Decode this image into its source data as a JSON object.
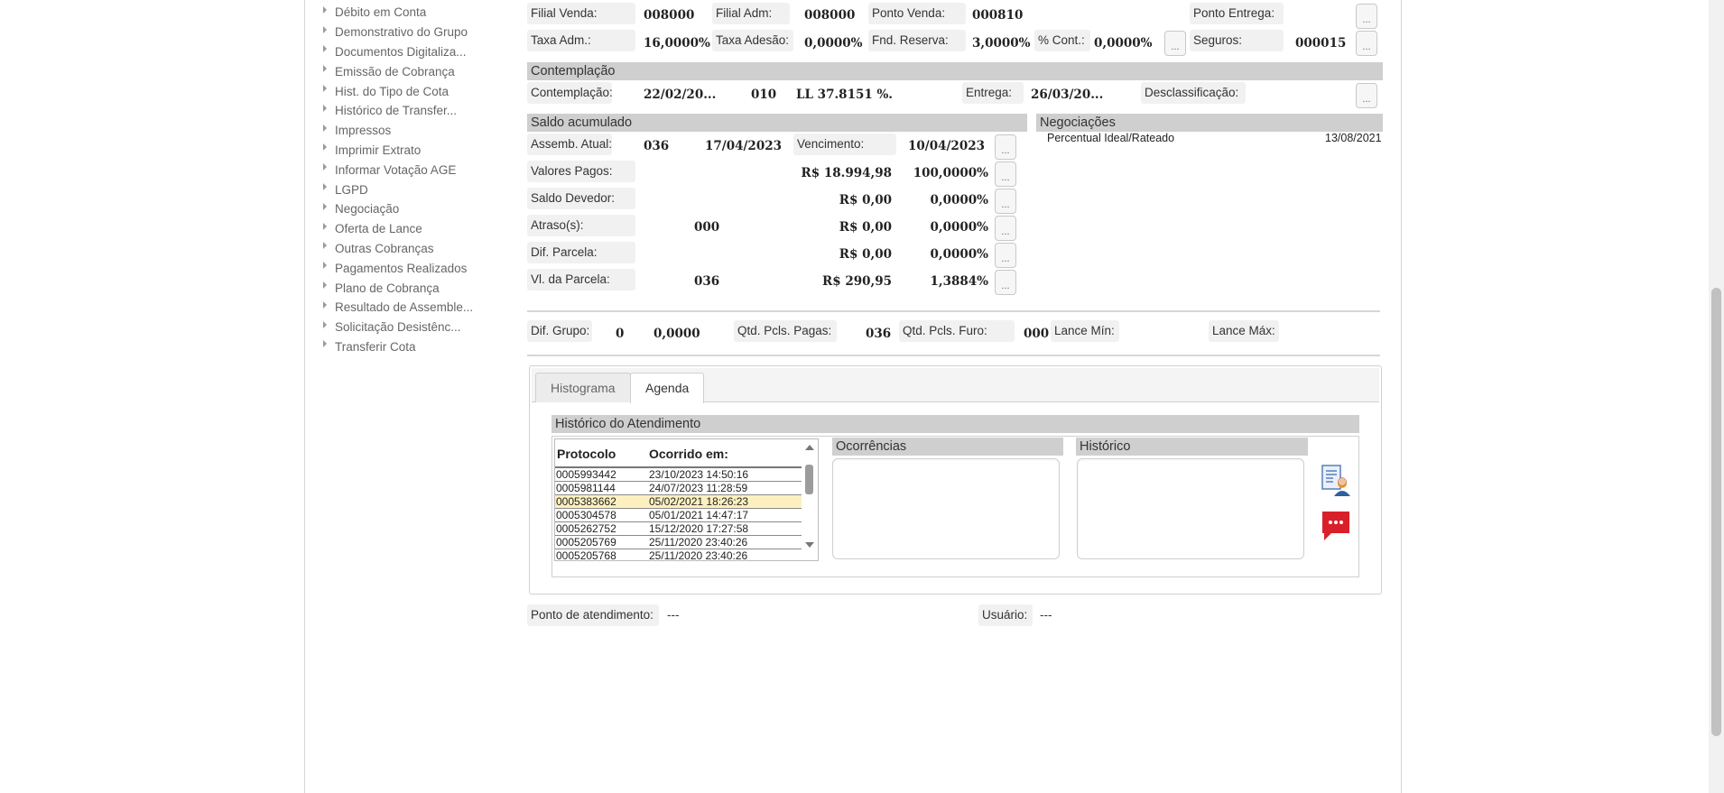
{
  "sidebar": {
    "items": [
      "Débito em Conta",
      "Demonstrativo do Grupo",
      "Documentos Digitaliza...",
      "Emissão de Cobrança",
      "Hist. do Tipo de Cota",
      "Histórico de Transfer...",
      "Impressos",
      "Imprimir Extrato",
      "Informar Votação AGE",
      "LGPD",
      "Negociação",
      "Oferta de Lance",
      "Outras Cobranças",
      "Pagamentos Realizados",
      "Plano de Cobrança",
      "Resultado de Assemble...",
      "Solicitação Desistênc...",
      "Transferir Cota"
    ]
  },
  "top": {
    "filial_venda_label": "Filial Venda:",
    "filial_venda": "008000",
    "filial_adm_label": "Filial Adm:",
    "filial_adm": "008000",
    "ponto_venda_label": "Ponto Venda:",
    "ponto_venda": "000810",
    "ponto_entrega_label": "Ponto Entrega:",
    "taxa_adm_label": "Taxa Adm.:",
    "taxa_adm": "16,0000%",
    "taxa_adesao_label": "Taxa Adesão:",
    "taxa_adesao": "0,0000%",
    "fnd_reserva_label": "Fnd. Reserva:",
    "fnd_reserva": "3,0000%",
    "cont_label": "% Cont.:",
    "cont": "0,0000%",
    "seguros_label": "Seguros:",
    "seguros": "000015"
  },
  "contemplacao": {
    "title": "Contemplação",
    "label": "Contemplação:",
    "data": "22/02/20...",
    "codigo": "010",
    "lance": "LL 37.8151 %.",
    "entrega_label": "Entrega:",
    "entrega": "26/03/20...",
    "desclassificacao_label": "Desclassificação:"
  },
  "saldo": {
    "title": "Saldo acumulado",
    "assemb_label": "Assemb. Atual:",
    "assemb": "036",
    "assemb_data": "17/04/2023",
    "vencimento_label": "Vencimento:",
    "vencimento": "10/04/2023",
    "rows": [
      {
        "label": "Valores Pagos:",
        "num": "",
        "valor": "R$ 18.994,98",
        "pct": "100,0000%"
      },
      {
        "label": "Saldo Devedor:",
        "num": "",
        "valor": "R$ 0,00",
        "pct": "0,0000%"
      },
      {
        "label": "Atraso(s):",
        "num": "000",
        "valor": "R$ 0,00",
        "pct": "0,0000%"
      },
      {
        "label": "Dif. Parcela:",
        "num": "",
        "valor": "R$ 0,00",
        "pct": "0,0000%"
      },
      {
        "label": "Vl. da Parcela:",
        "num": "036",
        "valor": "R$ 290,95",
        "pct": "1,3884%"
      }
    ]
  },
  "negociacoes": {
    "title": "Negociações",
    "item": "Percentual Ideal/Rateado",
    "date": "13/08/2021"
  },
  "grupo": {
    "dif_grupo_label": "Dif. Grupo:",
    "dif_grupo_num": "0",
    "dif_grupo_val": "0,0000",
    "pagas_label": "Qtd. Pcls. Pagas:",
    "pagas": "036",
    "furo_label": "Qtd. Pcls. Furo:",
    "furo": "000",
    "lance_min_label": "Lance Mín:",
    "lance_max_label": "Lance Máx:"
  },
  "tabs": {
    "histograma": "Histograma",
    "agenda": "Agenda"
  },
  "historico": {
    "title": "Histórico do Atendimento",
    "col_protocolo": "Protocolo",
    "col_ocorrido": "Ocorrido em:",
    "rows": [
      {
        "protocolo": "0005993442",
        "data": "23/10/2023 14:50:16"
      },
      {
        "protocolo": "0005981144",
        "data": "24/07/2023 11:28:59"
      },
      {
        "protocolo": "0005383662",
        "data": "05/02/2021 18:26:23"
      },
      {
        "protocolo": "0005304578",
        "data": "05/01/2021 14:47:17"
      },
      {
        "protocolo": "0005262752",
        "data": "15/12/2020 17:27:58"
      },
      {
        "protocolo": "0005205769",
        "data": "25/11/2020 23:40:26"
      },
      {
        "protocolo": "0005205768",
        "data": "25/11/2020 23:40:26"
      }
    ],
    "ocorrencias": "Ocorrências",
    "historico": "Histórico"
  },
  "footer": {
    "ponto_label": "Ponto de atendimento:",
    "ponto": "---",
    "usuario_label": "Usuário:",
    "usuario": "---"
  },
  "dots": "...",
  "icons": {
    "report": "report-user-icon",
    "message": "message-bubble-icon"
  },
  "colors": {
    "section_bg": "#cfcfcf",
    "selected_row": "#fcf0c0",
    "message_red": "#d9202a"
  }
}
